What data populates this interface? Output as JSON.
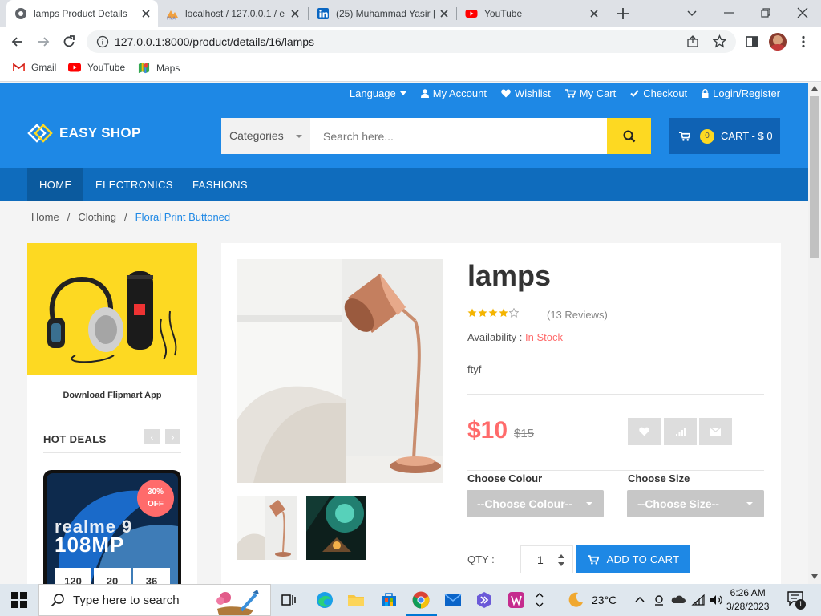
{
  "browser": {
    "tabs": [
      {
        "title": "lamps Product Details",
        "active": true
      },
      {
        "title": "localhost / 127.0.0.1 / e",
        "active": false
      },
      {
        "title": "(25) Muhammad Yasir |",
        "active": false
      },
      {
        "title": "YouTube",
        "active": false
      }
    ],
    "url": "127.0.0.1:8000/product/details/16/lamps",
    "bookmarks": [
      "Gmail",
      "YouTube",
      "Maps"
    ]
  },
  "site": {
    "top_links": {
      "language": "Language",
      "account": "My Account",
      "wishlist": "Wishlist",
      "cart": "My Cart",
      "checkout": "Checkout",
      "login": "Login/Register"
    },
    "logo": "EASY SHOP",
    "search": {
      "category": "Categories",
      "placeholder": "Search here..."
    },
    "cart": {
      "count": "0",
      "label": "CART - $ 0"
    },
    "nav": [
      "HOME",
      "ELECTRONICS",
      "FASHIONS"
    ],
    "breadcrumb": [
      "Home",
      "/",
      "Clothing",
      "/",
      "Floral Print Buttoned"
    ],
    "sidebar": {
      "promo_caption": "Download Flipmart App",
      "hot_deals_title": "HOT DEALS",
      "deal_badge_line1": "30%",
      "deal_badge_line2": "OFF",
      "phone_text_1": "realme 9",
      "phone_text_2": "108MP",
      "countdown": [
        "120",
        "20",
        "36"
      ]
    },
    "product": {
      "name": "lamps",
      "rating": 4,
      "rating_max": 5,
      "reviews": "(13 Reviews)",
      "availability_label": "Availability :",
      "availability_value": "In Stock",
      "description": "ftyf",
      "price": "$10",
      "old_price": "$15",
      "colour_label": "Choose Colour",
      "colour_value": "--Choose Colour--",
      "size_label": "Choose Size",
      "size_value": "--Choose Size--",
      "qty_label": "QTY :",
      "qty_value": "1",
      "add_to_cart": "ADD TO CART"
    }
  },
  "taskbar": {
    "search_placeholder": "Type here to search",
    "weather": "23°C",
    "time": "6:26 AM",
    "date": "3/28/2023",
    "notifications": "1"
  },
  "colors": {
    "brand_blue": "#1e88e5",
    "nav_blue": "#0f6cbd",
    "accent_yellow": "#fdd922",
    "price_red": "#ff6b6b"
  }
}
